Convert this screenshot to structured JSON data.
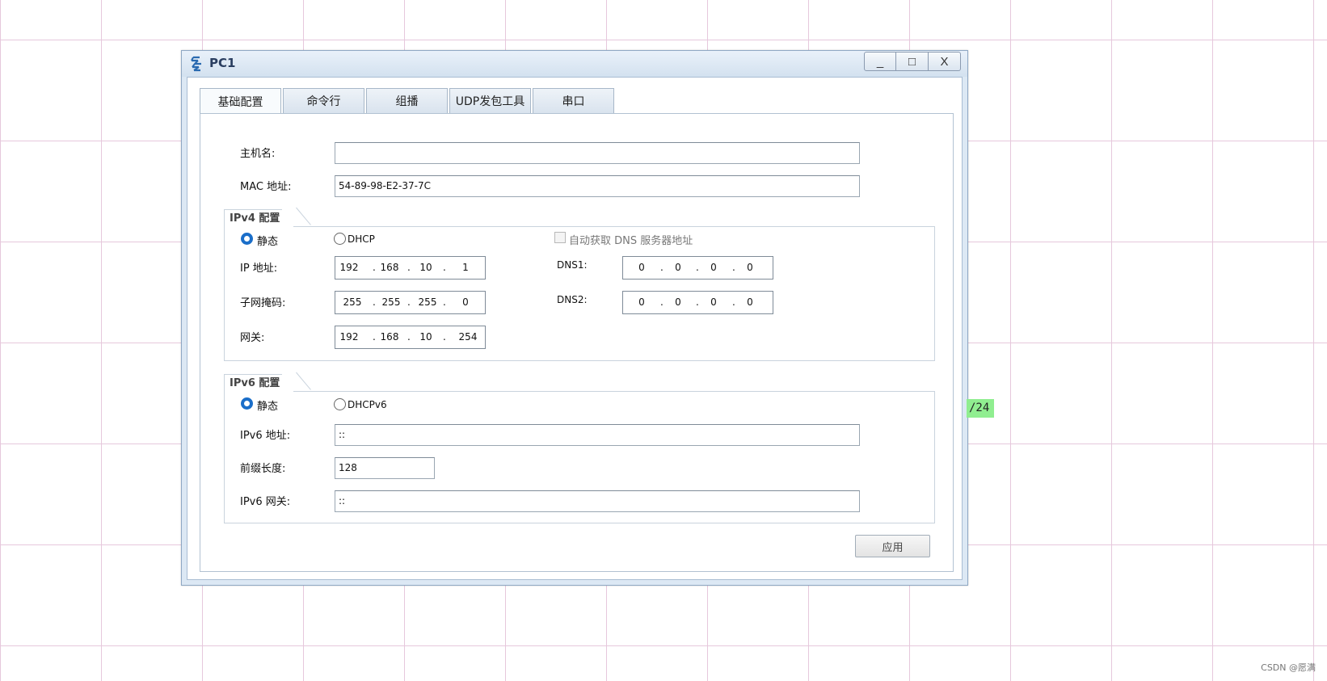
{
  "window": {
    "title": "PC1",
    "minimize": "_",
    "maximize": "□",
    "close": "X"
  },
  "tabs": [
    "基础配置",
    "命令行",
    "组播",
    "UDP发包工具",
    "串口"
  ],
  "basic": {
    "hostname_label": "主机名:",
    "hostname_value": "",
    "mac_label": "MAC 地址:",
    "mac_value": "54-89-98-E2-37-7C"
  },
  "ipv4": {
    "group_title": "IPv4 配置",
    "static_label": "静态",
    "dhcp_label": "DHCP",
    "auto_dns_label": "自动获取 DNS 服务器地址",
    "ip_label": "IP 地址:",
    "ip": [
      "192",
      "168",
      "10",
      "1"
    ],
    "mask_label": "子网掩码:",
    "mask": [
      "255",
      "255",
      "255",
      "0"
    ],
    "gateway_label": "网关:",
    "gateway": [
      "192",
      "168",
      "10",
      "254"
    ],
    "dns1_label": "DNS1:",
    "dns1": [
      "0",
      "0",
      "0",
      "0"
    ],
    "dns2_label": "DNS2:",
    "dns2": [
      "0",
      "0",
      "0",
      "0"
    ]
  },
  "ipv6": {
    "group_title": "IPv6 配置",
    "static_label": "静态",
    "dhcp_label": "DHCPv6",
    "addr_label": "IPv6 地址:",
    "addr_value": "::",
    "prefix_label": "前缀长度:",
    "prefix_value": "128",
    "gateway_label": "IPv6 网关:",
    "gateway_value": "::"
  },
  "apply_label": "应用",
  "background_tag": "/24",
  "footer_text": "CSDN @愿满"
}
